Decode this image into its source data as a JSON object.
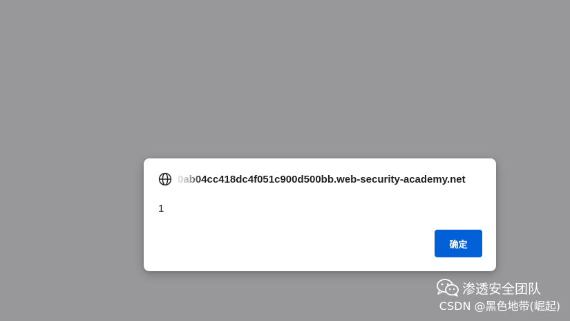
{
  "dialog": {
    "origin": "0ab04cc418dc4f051c900d500bb.web-security-academy.net",
    "message": "1",
    "ok_label": "确定",
    "globe_icon": "globe-icon"
  },
  "watermark": {
    "name": "渗透安全团队",
    "credit": "CSDN @黑色地带(崛起)",
    "icon": "wechat-icon"
  },
  "colors": {
    "overlay": "#98989a",
    "dialog_bg": "#ffffff",
    "button_bg": "#0160d8",
    "text": "#202124"
  }
}
